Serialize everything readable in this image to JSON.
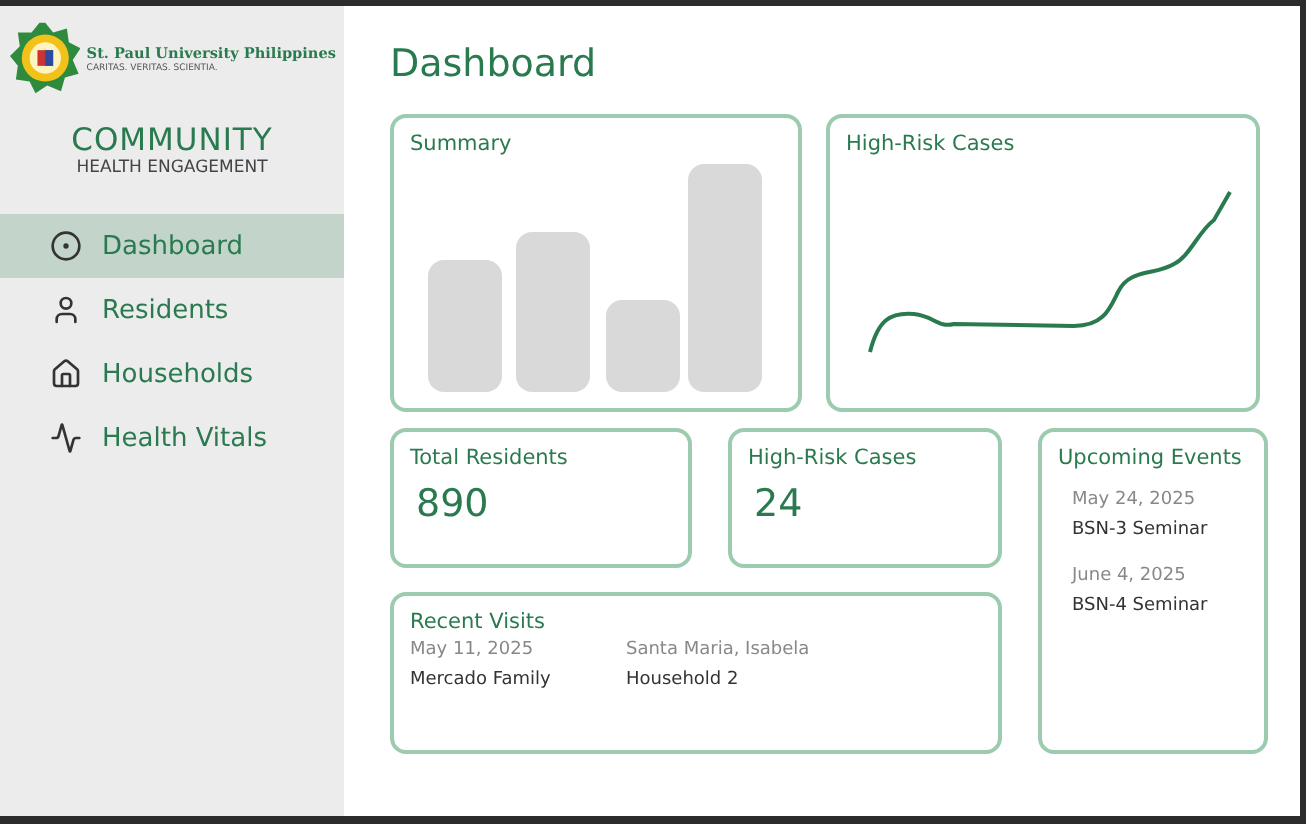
{
  "brand": {
    "name": "St. Paul University Philippines",
    "motto": "CARITAS. VERITAS. SCIENTIA."
  },
  "app": {
    "title": "COMMUNITY",
    "subtitle": "HEALTH ENGAGEMENT"
  },
  "nav": [
    {
      "label": "Dashboard",
      "selected": true
    },
    {
      "label": "Residents",
      "selected": false
    },
    {
      "label": "Households",
      "selected": false
    },
    {
      "label": "Health Vitals",
      "selected": false
    }
  ],
  "page_title": "Dashboard",
  "summary": {
    "title": "Summary"
  },
  "trend": {
    "title": "High-Risk Cases"
  },
  "stats": [
    {
      "label": "Total Residents",
      "value": "890"
    },
    {
      "label": "High-Risk Cases",
      "value": "24"
    }
  ],
  "events": {
    "title": "Upcoming Events",
    "items": [
      {
        "date": "May 24, 2025",
        "name": "BSN-3 Seminar"
      },
      {
        "date": "June 4, 2025",
        "name": "BSN-4 Seminar"
      }
    ]
  },
  "visits": {
    "title": "Recent Visits",
    "rows": [
      {
        "date": "May 11, 2025",
        "place": "Santa Maria, Isabela",
        "family": "Mercado Family",
        "household": "Household 2"
      }
    ]
  }
}
